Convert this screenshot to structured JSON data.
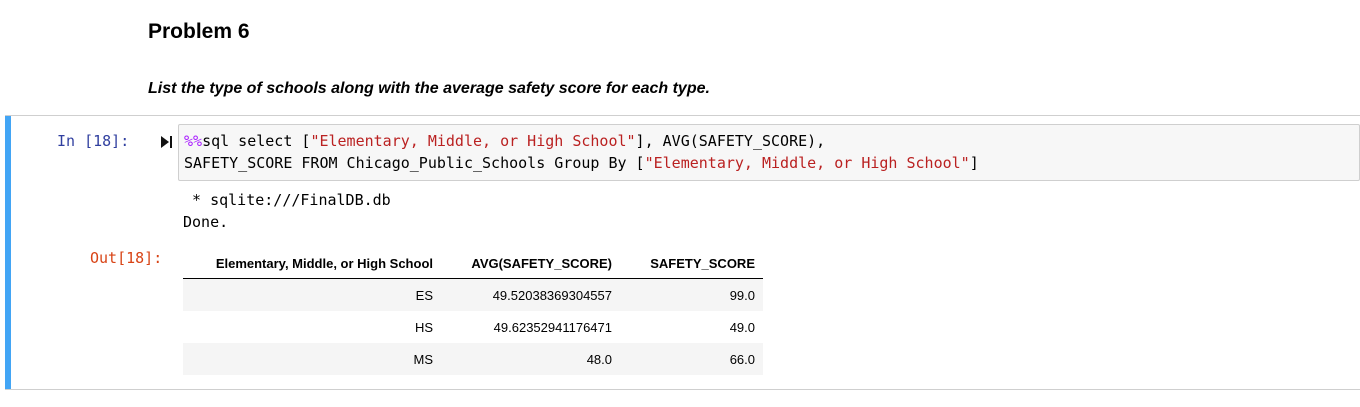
{
  "markdown": {
    "title": "Problem 6",
    "prompt": "List the type of schools along with the average safety score for each type."
  },
  "code_cell": {
    "input_prompt": "In [18]:",
    "run_icon": "run-cell-icon",
    "code_line_1": {
      "magic": "%%",
      "before_string": "sql select [",
      "string": "\"Elementary, Middle, or High School\"",
      "after_string": "], AVG(SAFETY_SCORE),"
    },
    "code_line_2": {
      "before_string": "SAFETY_SCORE FROM Chicago_Public_Schools Group By [",
      "string": "\"Elementary, Middle, or High School\"",
      "after_string": "]"
    },
    "stream_output": " * sqlite:///FinalDB.db\nDone.",
    "output_prompt": "Out[18]:"
  },
  "result_table": {
    "columns": [
      "Elementary, Middle, or High School",
      "AVG(SAFETY_SCORE)",
      "SAFETY_SCORE"
    ],
    "rows": [
      [
        "ES",
        "49.52038369304557",
        "99.0"
      ],
      [
        "HS",
        "49.62352941176471",
        "49.0"
      ],
      [
        "MS",
        "48.0",
        "66.0"
      ]
    ]
  },
  "colors": {
    "selection_bar": "#42a5f5",
    "input_prompt": "#303f9f",
    "output_prompt": "#d84315",
    "sql_magic": "#aa22ff",
    "sql_string": "#ba2121"
  }
}
